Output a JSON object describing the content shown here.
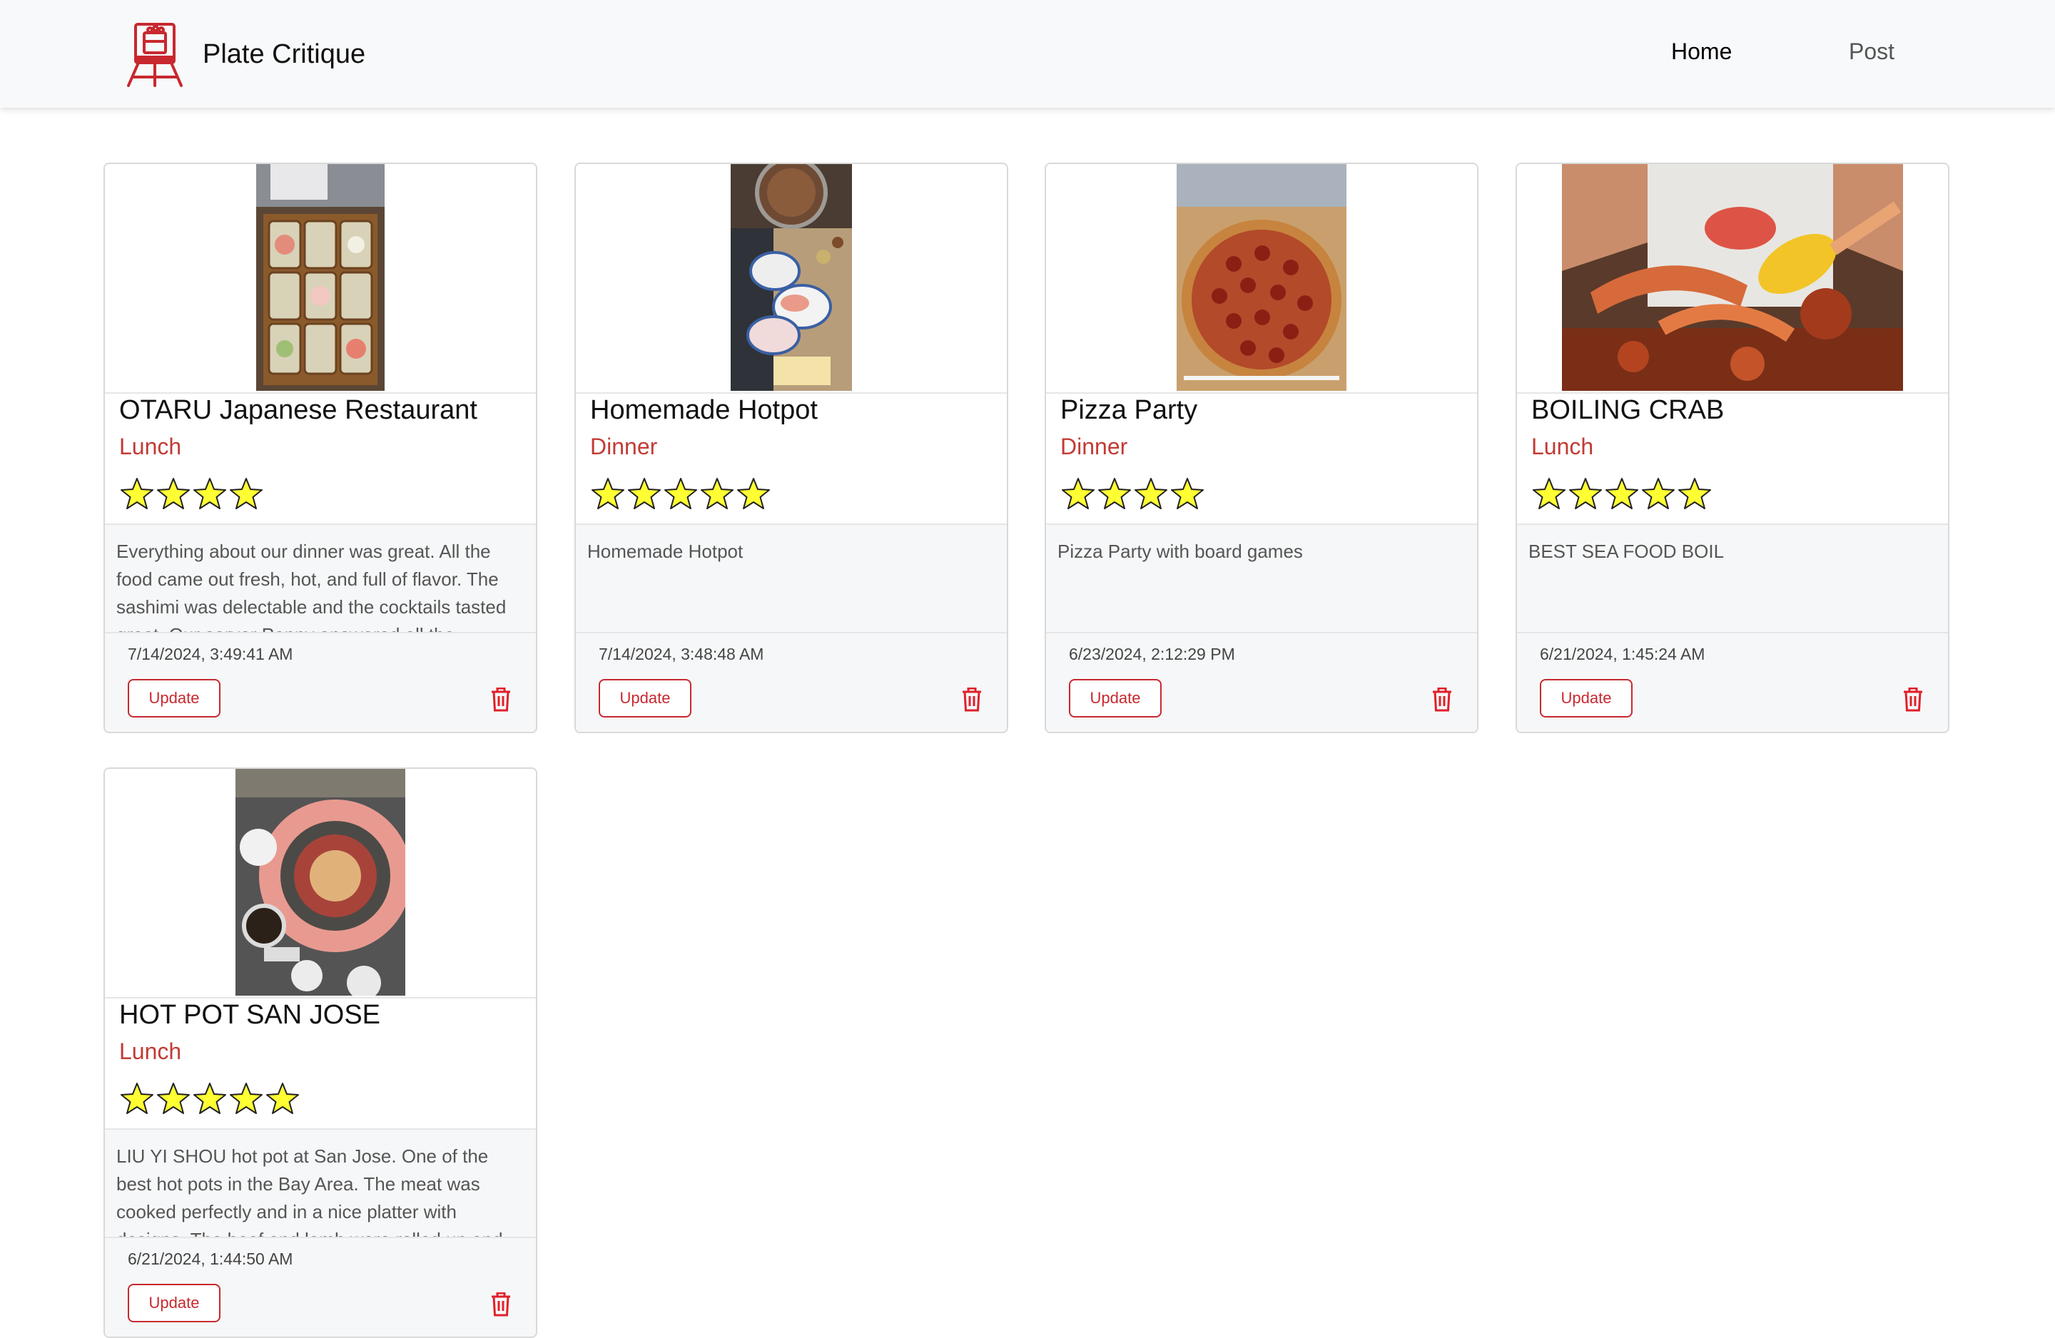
{
  "nav": {
    "brand": "Plate Critique",
    "links": [
      {
        "label": "Home",
        "active": true
      },
      {
        "label": "Post",
        "active": false
      }
    ]
  },
  "colors": {
    "accent": "#c7292f",
    "meal": "#c23b34",
    "star_fill": "#ffff33"
  },
  "cards": [
    {
      "title": "OTARU Japanese Restaurant",
      "meal": "Lunch",
      "rating": 4,
      "description": "Everything about our dinner was great. All the food came out fresh, hot, and full of flavor. The sashimi was delectable and the cocktails tasted great. Our server Penny answered all the",
      "timestamp": "7/14/2024, 3:49:41 AM",
      "update_label": "Update",
      "photo": "sashimi-box"
    },
    {
      "title": "Homemade Hotpot",
      "meal": "Dinner",
      "rating": 5,
      "description": "Homemade Hotpot",
      "timestamp": "7/14/2024, 3:48:48 AM",
      "update_label": "Update",
      "photo": "hotpot-table"
    },
    {
      "title": "Pizza Party",
      "meal": "Dinner",
      "rating": 4,
      "description": "Pizza Party with board games",
      "timestamp": "6/23/2024, 2:12:29 PM",
      "update_label": "Update",
      "photo": "pepperoni-pizza"
    },
    {
      "title": "BOILING CRAB",
      "meal": "Lunch",
      "rating": 5,
      "description": "BEST SEA FOOD BOIL",
      "timestamp": "6/21/2024, 1:45:24 AM",
      "update_label": "Update",
      "photo": "seafood-boil"
    },
    {
      "title": "HOT POT SAN JOSE",
      "meal": "Lunch",
      "rating": 5,
      "description": "LIU YI SHOU hot pot at San Jose. One of the best hot pots in the Bay Area. The meat was cooked perfectly and in a nice platter with designs. The beef and lamb were rolled up and",
      "timestamp": "6/21/2024, 1:44:50 AM",
      "update_label": "Update",
      "photo": "hotpot-platter"
    }
  ]
}
